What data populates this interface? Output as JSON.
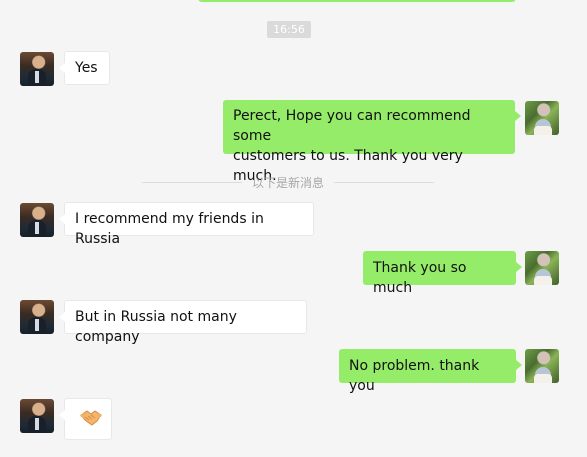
{
  "chat": {
    "timestamp": "16:56",
    "divider_label": "以下是新消息",
    "messages": [
      {
        "side": "left",
        "text": "Yes"
      },
      {
        "side": "right",
        "line1": "Perect, Hope you can recommend some",
        "line2": "customers to us. Thank you very much."
      },
      {
        "side": "left",
        "text": "I recommend my friends in Russia"
      },
      {
        "side": "right",
        "text": "Thank you so much"
      },
      {
        "side": "left",
        "text": "But in Russia not many company"
      },
      {
        "side": "right",
        "text": "No problem. thank you"
      },
      {
        "side": "left",
        "emoji": "handshake-emoji"
      }
    ]
  },
  "colors": {
    "background": "#f5f5f5",
    "outgoing_bubble": "#95ec69",
    "incoming_bubble": "#ffffff",
    "timestamp_bg": "#dadada",
    "divider_text": "#a7a7a7"
  },
  "icons": {
    "handshake": "handshake-icon"
  }
}
